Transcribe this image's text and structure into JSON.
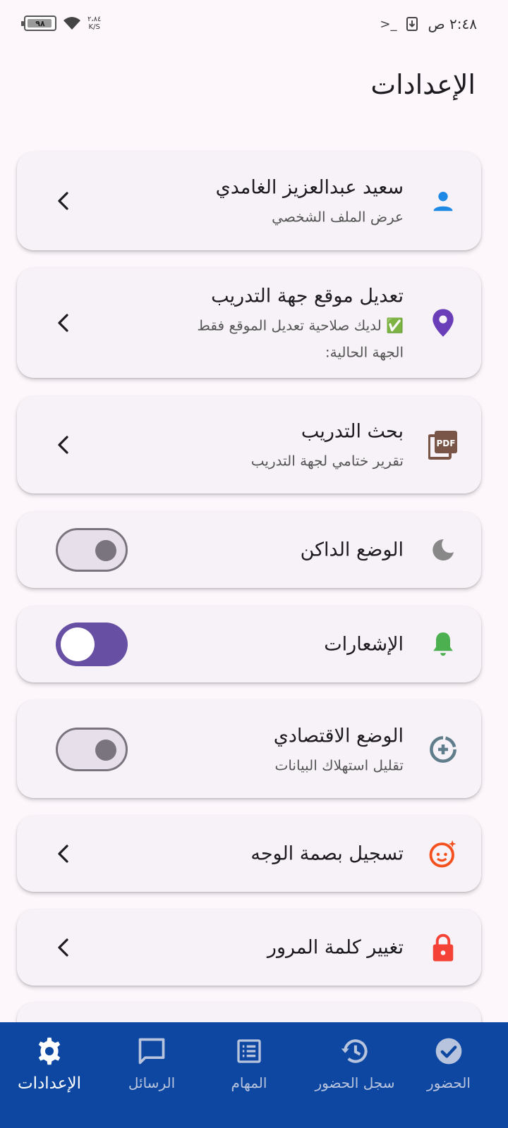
{
  "status_bar": {
    "battery": "٩٨",
    "net_speed_value": "٢،٨٤",
    "net_speed_unit": "K/S",
    "time": "٢:٤٨ ص"
  },
  "page": {
    "title": "الإعدادات"
  },
  "settings": [
    {
      "title": "سعيد عبدالعزيز الغامدي",
      "subtitle": "عرض الملف الشخصي",
      "icon": "person-icon",
      "icon_color": "#1E88E5",
      "trailing": "chevron"
    },
    {
      "title": "تعديل موقع جهة التدريب",
      "subtitle": "✅ لديك صلاحية تعديل الموقع فقط",
      "subtitle2": "الجهة الحالية:",
      "icon": "location-pin-icon",
      "icon_color": "#6A3EB8",
      "trailing": "chevron"
    },
    {
      "title": "بحث التدريب",
      "subtitle": "تقرير ختامي لجهة التدريب",
      "icon": "pdf-icon",
      "icon_color": "#795548",
      "trailing": "chevron"
    },
    {
      "title": "الوضع الداكن",
      "icon": "moon-icon",
      "icon_color": "#888888",
      "trailing": "switch",
      "switch_on": false
    },
    {
      "title": "الإشعارات",
      "icon": "bell-icon",
      "icon_color": "#4CAF50",
      "trailing": "switch",
      "switch_on": true
    },
    {
      "title": "الوضع الاقتصادي",
      "subtitle": "تقليل استهلاك البيانات",
      "icon": "data-saver-icon",
      "icon_color": "#607D8B",
      "trailing": "switch",
      "switch_on": false
    },
    {
      "title": "تسجيل بصمة الوجه",
      "icon": "face-icon",
      "icon_color": "#F4511E",
      "trailing": "chevron"
    },
    {
      "title": "تغيير كلمة المرور",
      "icon": "lock-icon",
      "icon_color": "#F44336",
      "trailing": "chevron"
    }
  ],
  "bottom_nav": [
    {
      "label": "الإعدادات",
      "icon": "gear-icon",
      "active": true
    },
    {
      "label": "الرسائل",
      "icon": "chat-icon",
      "active": false
    },
    {
      "label": "المهام",
      "icon": "tasks-icon",
      "active": false
    },
    {
      "label": "سجل الحضور",
      "icon": "history-icon",
      "active": false
    },
    {
      "label": "الحضور",
      "icon": "check-circle-icon",
      "active": false
    }
  ],
  "colors": {
    "nav_bg": "#0D47A1",
    "accent": "#6750A4",
    "page_bg": "#FDF7FC"
  }
}
